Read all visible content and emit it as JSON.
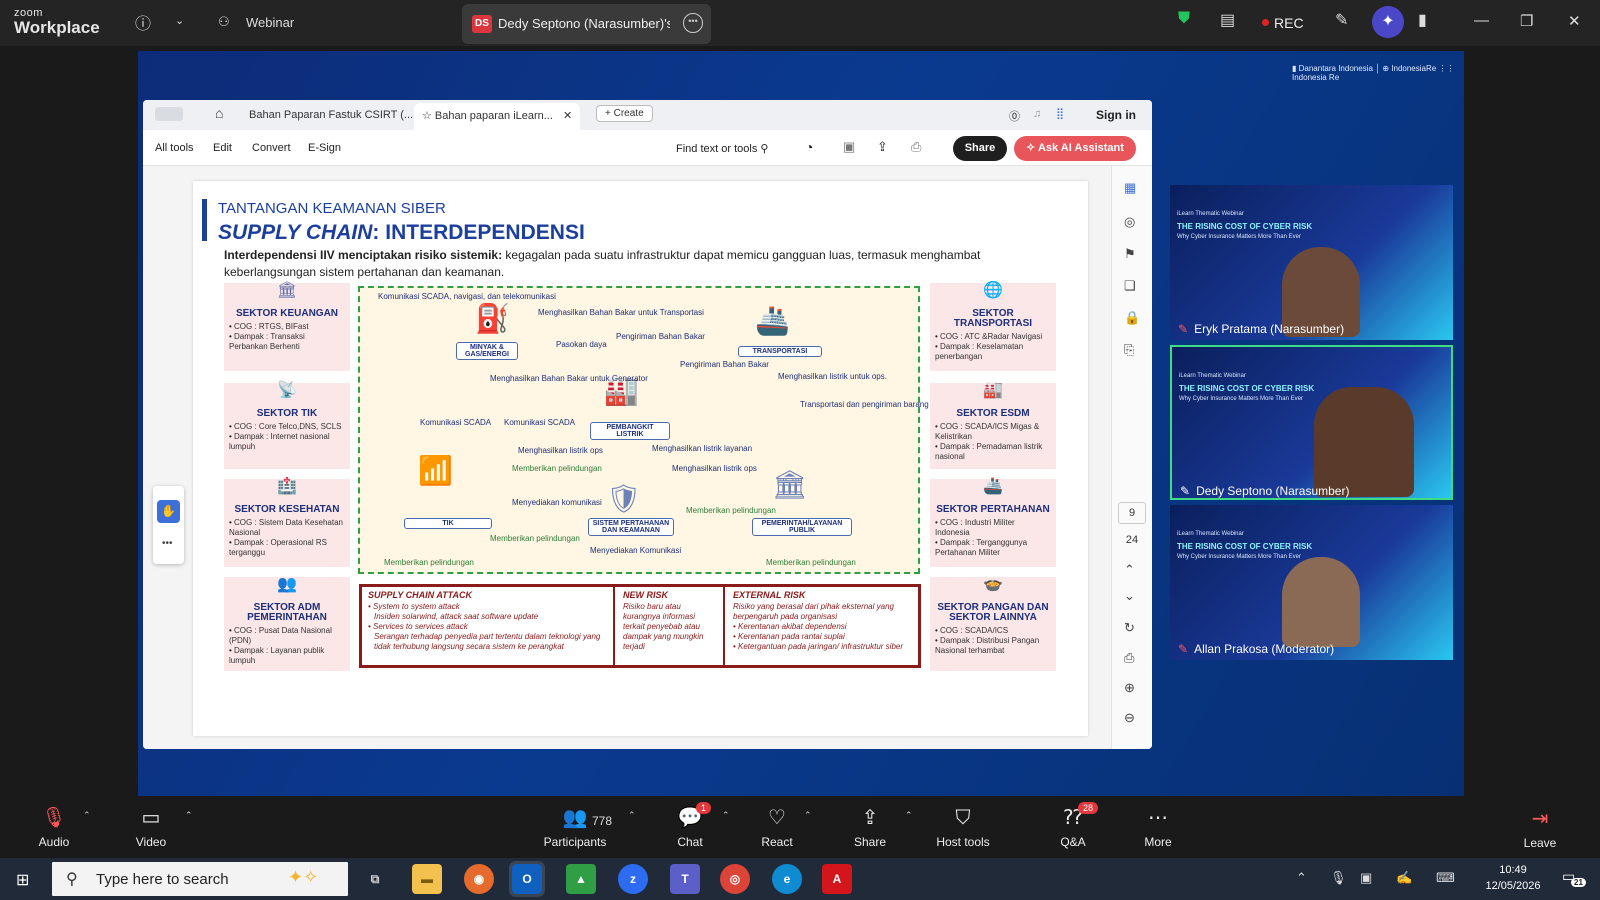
{
  "titlebar": {
    "logo_top": "zoom",
    "logo_bottom": "Workplace",
    "info_icon": "info-icon",
    "meeting_name": "Webinar",
    "share_initials": "DS",
    "share_title": "Dedy Septono (Narasumber)'s sc",
    "rec_label": "REC"
  },
  "acrobat": {
    "tabs": [
      {
        "label": "Bahan Paparan Fastuk CSIRT (..."
      },
      {
        "label": "Bahan paparan iLearn..."
      }
    ],
    "create_label": "Create",
    "signin_label": "Sign in",
    "menu": [
      "All tools",
      "Edit",
      "Convert",
      "E-Sign"
    ],
    "find_label": "Find text or tools",
    "share_label": "Share",
    "ai_label": "Ask AI Assistant",
    "page_current": "9",
    "page_total": "24"
  },
  "slide": {
    "heading": "TANTANGAN KEAMANAN SIBER",
    "title_italic": "SUPPLY CHAIN",
    "title_rest": ": INTERDEPENDENSI",
    "intro_bold": "Interdependensi IIV menciptakan risiko sistemik:",
    "intro_rest": " kegagalan pada suatu infrastruktur dapat memicu gangguan luas, termasuk menghambat keberlangsungan sistem pertahanan dan keamanan.",
    "left_sectors": [
      {
        "title": "SEKTOR KEUANGAN",
        "cog": "COG : RTGS, BIFast",
        "dampak": "Dampak : Transaksi Perbankan Berhenti"
      },
      {
        "title": "SEKTOR TIK",
        "cog": "COG : Core Telco,DNS, SCLS",
        "dampak": "Dampak : Internet nasional lumpuh"
      },
      {
        "title": "SEKTOR KESEHATAN",
        "cog": "COG : Sistem Data Kesehatan Nasional",
        "dampak": "Dampak : Operasional RS terganggu"
      },
      {
        "title": "SEKTOR ADM PEMERINTAHAN",
        "cog": "COG : Pusat Data Nasional (PDN)",
        "dampak": "Dampak : Layanan publik lumpuh"
      }
    ],
    "right_sectors": [
      {
        "title": "SEKTOR TRANSPORTASI",
        "cog": "COG : ATC &Radar Navigasi",
        "dampak": "Dampak : Keselamatan penerbangan"
      },
      {
        "title": "SEKTOR ESDM",
        "cog": "COG : SCADA/ICS Migas & Kelistrikan",
        "dampak": "Dampak : Pemadaman listrik nasional"
      },
      {
        "title": "SEKTOR PERTAHANAN",
        "cog": "COG : Industri Militer Indonesia",
        "dampak": "Dampak : Terganggunya Pertahanan Militer"
      },
      {
        "title": "SEKTOR PANGAN DAN SEKTOR LAINNYA",
        "cog": "COG : SCADA/ICS",
        "dampak": "Dampak : Distribusi Pangan Nasional terhambat"
      }
    ],
    "nodes": {
      "migas": "MINYAK & GAS/ENERGI",
      "transport": "TRANSPORTASI",
      "listrik": "PEMBANGKIT LISTRIK",
      "tik": "TIK",
      "hankam": "SISTEM PERTAHANAN DAN KEAMANAN",
      "pemerintah": "PEMERINTAH/LAYANAN PUBLIK"
    },
    "flows": [
      "Komunikasi SCADA, navigasi, dan telekomunikasi",
      "Menghasilkan Bahan Bakar untuk Transportasi",
      "Pasokan daya",
      "Pengiriman Bahan Bakar",
      "Menghasilkan Bahan Bakar untuk Generator",
      "Pengiriman Bahan Bakar",
      "Menghasilkan listrik untuk ops.",
      "Transportasi dan pengiriman barang",
      "Komunikasi SCADA",
      "Komunikasi SCADA",
      "Menghasilkan listrik ops",
      "Menghasilkan listrik layanan",
      "Memberikan pelindungan",
      "Menghasilkan listrik ops",
      "Menyediakan komunikasi",
      "Memberikan pelindungan",
      "Memberikan pelindungan",
      "Menyediakan Komunikasi",
      "Memberikan pelindungan",
      "Memberikan pelindungan"
    ],
    "risks": [
      {
        "title": "SUPPLY CHAIN ATTACK",
        "lines": [
          "• System to system attack",
          "Insiden solarwind, attack saat software update",
          "• Services to services attack",
          "Serangan terhadap penyedia part tertentu dalam teknologi yang tidak terhubung langsung secara sistem ke perangkat"
        ]
      },
      {
        "title": "NEW RISK",
        "lines": [
          "Risiko baru atau kurangnya informasi terkait penyebab atau dampak yang mungkin terjadi"
        ]
      },
      {
        "title": "EXTERNAL RISK",
        "lines": [
          "Risiko yang berasal dari pihak eksternal yang berpengaruh pada organisasi",
          "• Kerentanan akibat dependensi",
          "• Kerentanan pada rantai suplai",
          "• Ketergantuan pada jaringan/ infrastruktur siber"
        ]
      }
    ]
  },
  "videos": [
    {
      "name": "Eryk Pratama (Narasumber)",
      "title": "THE RISING COST OF CYBER RISK",
      "sub": "iLearn Thematic Webinar",
      "desc": "Why Cyber Insurance Matters More Than Ever"
    },
    {
      "name": "Dedy Septono (Narasumber)",
      "title": "THE RISING COST OF CYBER RISK",
      "sub": "iLearn Thematic Webinar",
      "desc": "Why Cyber Insurance Matters More Than Ever"
    },
    {
      "name": "Allan Prakosa (Moderator)",
      "title": "THE RISING COST OF CYBER RISK",
      "sub": "iLearn Thematic Webinar",
      "desc": "Why Cyber Insurance Matters More Than Ever"
    }
  ],
  "controls": {
    "audio": "Audio",
    "video": "Video",
    "participants": "Participants",
    "participants_count": "778",
    "chat": "Chat",
    "chat_badge": "1",
    "react": "React",
    "share": "Share",
    "host_tools": "Host tools",
    "qa": "Q&A",
    "qa_badge": "28",
    "more": "More",
    "leave": "Leave"
  },
  "taskbar": {
    "search_placeholder": "Type here to search",
    "time": "10:49",
    "date": "12/05/2026",
    "notif_count": "21"
  },
  "colors": {
    "zoom_bg": "#242424",
    "slide_blue": "#1c3f9e",
    "rec_red": "#e02424",
    "ai_btn": "#e8555b",
    "active_border": "#3ddc84"
  }
}
